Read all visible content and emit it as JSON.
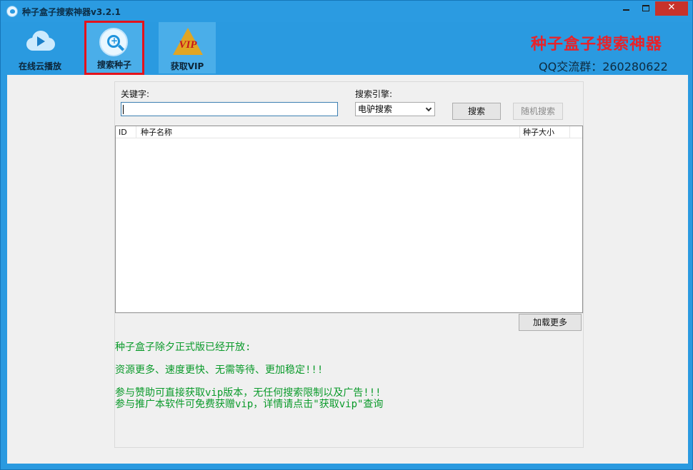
{
  "window": {
    "title": "种子盒子搜索神器v3.2.1"
  },
  "toolbar": {
    "items": [
      {
        "label": "在线云播放",
        "icon": "cloud-play-icon"
      },
      {
        "label": "搜索种子",
        "icon": "search-plus-icon",
        "selected": true
      },
      {
        "label": "获取VIP",
        "icon": "vip-icon"
      }
    ],
    "vip_icon_text": "VIP",
    "brand_title": "种子盒子搜索神器",
    "qq_group": "QQ交流群：260280622"
  },
  "search": {
    "keyword_label": "关键字:",
    "keyword_value": "",
    "engine_label": "搜索引擎:",
    "engine_selected": "电驴搜索",
    "search_button": "搜索",
    "random_button": "随机搜索"
  },
  "results": {
    "columns": [
      "ID",
      "种子名称",
      "种子大小"
    ],
    "rows": []
  },
  "load_more_button": "加载更多",
  "notice": {
    "lines": [
      "种子盒子除夕正式版已经开放:",
      "",
      "资源更多、速度更快、无需等待、更加稳定!!!",
      "",
      "参与赞助可直接获取vip版本，无任何搜索限制以及广告!!!",
      "参与推广本软件可免费获赠vip，详情请点击\"获取vip\"查询"
    ]
  },
  "colors": {
    "titlebar": "#2b9be1",
    "brand_red": "#e8232a",
    "notice_green": "#0a9a2a",
    "selected_outline": "#e4121b",
    "close_button": "#c7322b"
  }
}
